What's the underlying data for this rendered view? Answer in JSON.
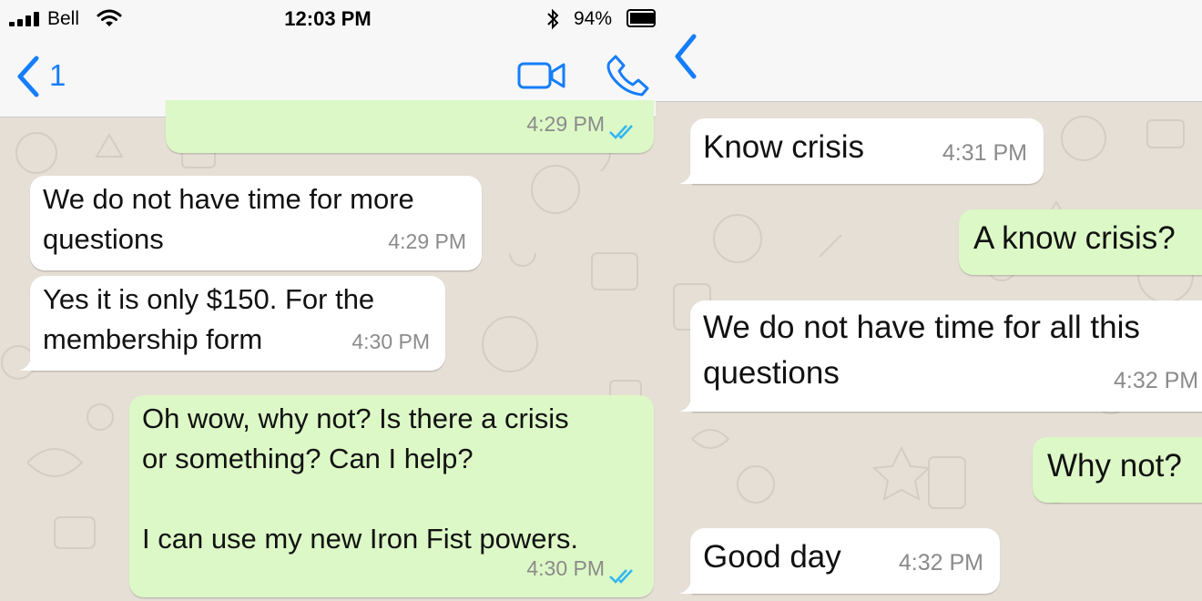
{
  "status_bar": {
    "carrier": "Bell",
    "time": "12:03 PM",
    "battery": "94%"
  },
  "left_chat": {
    "header": {
      "back_count": "1"
    },
    "messages": [
      {
        "dir": "out",
        "text": "",
        "time": "4:29 PM",
        "status": "read"
      },
      {
        "dir": "in",
        "lines": [
          "We do not have time for more",
          "questions"
        ],
        "time": "4:29 PM"
      },
      {
        "dir": "in",
        "lines": [
          "Yes it is only $150. For the",
          "membership form"
        ],
        "time": "4:30 PM"
      },
      {
        "dir": "out",
        "lines": [
          "Oh wow, why not? Is there a crisis",
          "or something? Can I help?",
          "",
          "I can use my new Iron Fist powers."
        ],
        "time": "4:30 PM",
        "status": "read"
      }
    ]
  },
  "right_chat": {
    "messages": [
      {
        "dir": "in",
        "lines": [
          "Know crisis"
        ],
        "time": "4:31 PM"
      },
      {
        "dir": "out",
        "lines": [
          "A know crisis?"
        ]
      },
      {
        "dir": "in",
        "lines": [
          "We do not have time for all this",
          "questions"
        ],
        "time": "4:32 PM"
      },
      {
        "dir": "out",
        "lines": [
          "Why not?"
        ]
      },
      {
        "dir": "in",
        "lines": [
          "Good day"
        ],
        "time": "4:32 PM"
      }
    ]
  },
  "icons": [
    "signal-bars-icon",
    "wifi-icon",
    "bluetooth-icon",
    "battery-icon",
    "back-chevron-icon",
    "video-call-icon",
    "phone-call-icon",
    "double-check-icon"
  ],
  "colors": {
    "accent": "#157efb",
    "incoming": "#ffffff",
    "outgoing": "#dcf8c6",
    "wallpaper": "#e6dfd6",
    "read_ticks": "#34b7f1"
  }
}
